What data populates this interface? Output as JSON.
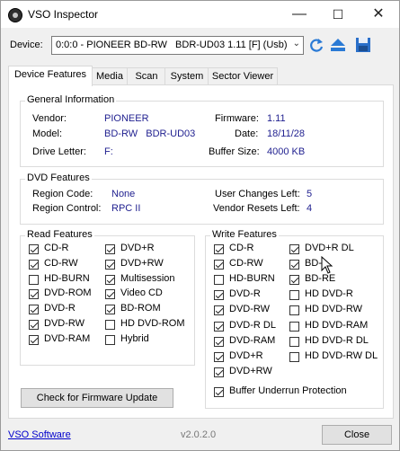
{
  "window": {
    "title": "VSO Inspector",
    "minimize": "—",
    "maximize": "☐",
    "close": "✕"
  },
  "device": {
    "label": "Device:",
    "selected": "0:0:0 - PIONEER BD-RW   BDR-UD03 1.11 [F] (Usb)",
    "icons": [
      "refresh-icon",
      "eject-icon",
      "save-icon"
    ]
  },
  "tabs": [
    "Device Features",
    "Media",
    "Scan",
    "System",
    "Sector Viewer"
  ],
  "general": {
    "title": "General Information",
    "vendor_label": "Vendor:",
    "vendor": "PIONEER",
    "model_label": "Model:",
    "model": "BD-RW   BDR-UD03",
    "drive_letter_label": "Drive Letter:",
    "drive_letter": "F:",
    "firmware_label": "Firmware:",
    "firmware": "1.11",
    "date_label": "Date:",
    "date": "18/11/28",
    "buffer_label": "Buffer Size:",
    "buffer": "4000 KB"
  },
  "dvd": {
    "title": "DVD Features",
    "region_code_label": "Region Code:",
    "region_code": "None",
    "region_control_label": "Region Control:",
    "region_control": "RPC II",
    "user_changes_label": "User Changes Left:",
    "user_changes": "5",
    "vendor_resets_label": "Vendor Resets Left:",
    "vendor_resets": "4"
  },
  "read": {
    "title": "Read Features",
    "col1": [
      {
        "label": "CD-R",
        "checked": true
      },
      {
        "label": "CD-RW",
        "checked": true
      },
      {
        "label": "HD-BURN",
        "checked": false
      },
      {
        "label": "DVD-ROM",
        "checked": true
      },
      {
        "label": "DVD-R",
        "checked": true
      },
      {
        "label": "DVD-RW",
        "checked": true
      },
      {
        "label": "DVD-RAM",
        "checked": true
      }
    ],
    "col2": [
      {
        "label": "DVD+R",
        "checked": true
      },
      {
        "label": "DVD+RW",
        "checked": true
      },
      {
        "label": "Multisession",
        "checked": true
      },
      {
        "label": "Video CD",
        "checked": true
      },
      {
        "label": "BD-ROM",
        "checked": true
      },
      {
        "label": "HD DVD-ROM",
        "checked": false
      },
      {
        "label": "Hybrid",
        "checked": false
      }
    ]
  },
  "write": {
    "title": "Write Features",
    "col1": [
      {
        "label": "CD-R",
        "checked": true
      },
      {
        "label": "CD-RW",
        "checked": true
      },
      {
        "label": "HD-BURN",
        "checked": false
      },
      {
        "label": "DVD-R",
        "checked": true
      },
      {
        "label": "DVD-RW",
        "checked": true
      },
      {
        "label": "DVD-R DL",
        "checked": true
      },
      {
        "label": "DVD-RAM",
        "checked": true
      },
      {
        "label": "DVD+R",
        "checked": true
      },
      {
        "label": "DVD+RW",
        "checked": true
      }
    ],
    "col2": [
      {
        "label": "DVD+R DL",
        "checked": true
      },
      {
        "label": "BD-",
        "checked": true
      },
      {
        "label": "BD-RE",
        "checked": true
      },
      {
        "label": "HD DVD-R",
        "checked": false
      },
      {
        "label": "HD DVD-RW",
        "checked": false
      },
      {
        "label": "HD DVD-RAM",
        "checked": false
      },
      {
        "label": "HD DVD-R DL",
        "checked": false
      },
      {
        "label": "HD DVD-RW DL",
        "checked": false
      }
    ],
    "buffer_underrun": {
      "label": "Buffer Underrun Protection",
      "checked": true
    }
  },
  "firmware_button": "Check for Firmware Update",
  "footer": {
    "link": "VSO Software",
    "version": "v2.0.2.0",
    "close": "Close"
  }
}
